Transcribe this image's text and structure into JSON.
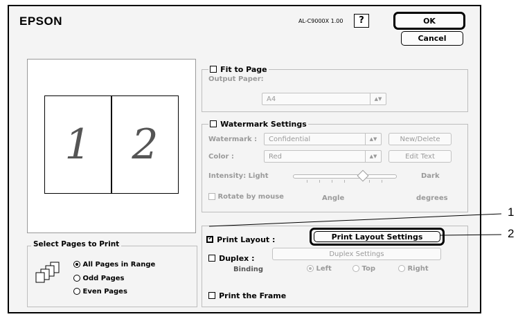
{
  "header": {
    "brand": "EPSON",
    "model": "AL-C9000X 1.00",
    "help_label": "?",
    "ok_label": "OK",
    "cancel_label": "Cancel"
  },
  "preview": {
    "page1": "1",
    "page2": "2"
  },
  "fit_to_page": {
    "label": "Fit to Page",
    "output_paper_label": "Output Paper:",
    "output_paper_value": "A4",
    "checked": false
  },
  "watermark": {
    "label": "Watermark Settings",
    "watermark_label": "Watermark :",
    "watermark_value": "Confidential",
    "new_delete_label": "New/Delete",
    "color_label": "Color :",
    "color_value": "Red",
    "edit_text_label": "Edit Text",
    "intensity_label": "Intensity: Light",
    "dark_label": "Dark",
    "rotate_label": "Rotate by mouse",
    "angle_label": "Angle",
    "degrees_label": "degrees",
    "checked": false
  },
  "print_layout": {
    "label": "Print Layout :",
    "settings_button": "Print Layout Settings",
    "checked": true
  },
  "duplex": {
    "label": "Duplex :",
    "settings_button": "Duplex Settings",
    "binding_label": "Binding",
    "options": [
      "Left",
      "Top",
      "Right"
    ],
    "selected": "Left"
  },
  "print_frame": {
    "label": "Print the Frame"
  },
  "select_pages": {
    "title": "Select Pages to Print",
    "options": [
      "All Pages in Range",
      "Odd Pages",
      "Even Pages"
    ],
    "selected": "All Pages in Range"
  },
  "callouts": [
    "1",
    "2"
  ]
}
